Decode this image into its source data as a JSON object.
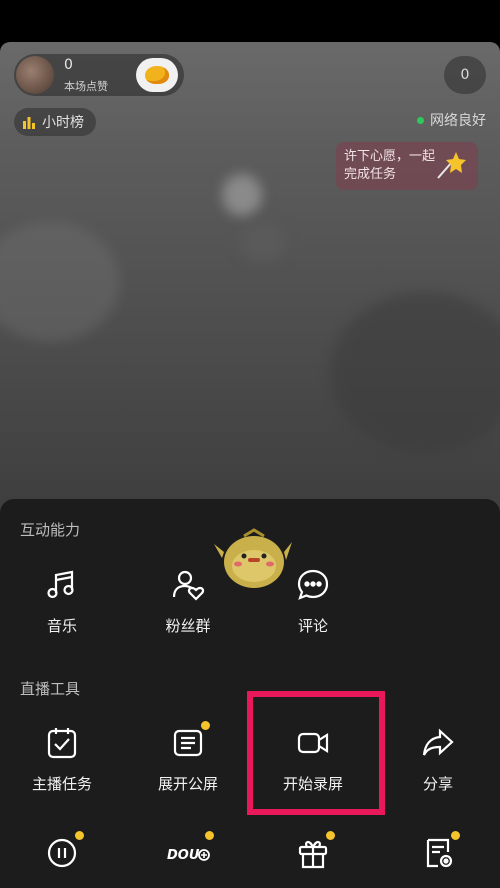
{
  "live": {
    "likes_count": "0",
    "likes_label": "本场点赞",
    "viewer_count": "0",
    "rank_label": "小时榜",
    "network_status": "网络良好",
    "wish_text": "许下心愿，一起完成任务"
  },
  "panel": {
    "section_interact": "互动能力",
    "section_tools": "直播工具",
    "interact_items": [
      {
        "label": "音乐",
        "icon": "music-icon"
      },
      {
        "label": "粉丝群",
        "icon": "fan-group-icon"
      },
      {
        "label": "评论",
        "icon": "comment-icon"
      }
    ],
    "tool_items": [
      {
        "label": "主播任务",
        "icon": "task-icon"
      },
      {
        "label": "展开公屏",
        "icon": "public-screen-icon"
      },
      {
        "label": "开始录屏",
        "icon": "record-icon"
      },
      {
        "label": "分享",
        "icon": "share-icon"
      }
    ],
    "bottom_icons": [
      "pause-icon",
      "dou-plus-icon",
      "gift-icon",
      "settings-doc-icon"
    ],
    "dou_label": "DOU"
  },
  "colors": {
    "panel_bg": "#1c1c1c",
    "highlight": "#e8185a",
    "badge_dot": "#f5c42c",
    "network_dot": "#2ec95a"
  }
}
